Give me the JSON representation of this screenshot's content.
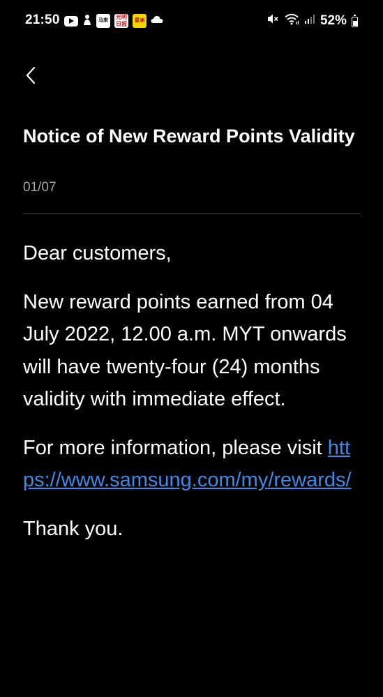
{
  "status_bar": {
    "time": "21:50",
    "app_icon_1": "马来",
    "app_icon_2_line1": "光明",
    "app_icon_2_line2": "日报",
    "app_icon_3": "星洲",
    "battery_percent": "52%",
    "icons": [
      "youtube-icon",
      "notification-icon",
      "app-icon",
      "app-icon",
      "app-icon",
      "cloud-icon",
      "mute-icon",
      "wifi-icon",
      "signal-icon",
      "battery-icon"
    ]
  },
  "header": {
    "back_icon": "chevron-left-icon",
    "title": "Notice of New Reward Points Validity",
    "date": "01/07"
  },
  "body": {
    "greeting": "Dear customers,",
    "paragraph": "New reward points earned from 04 July 2022, 12.00 a.m. MYT onwards will have twenty-four (24) months validity with immediate effect.",
    "info_prefix": "For more information, please visit",
    "link_text": "https://www.samsung.com/my/rewards/",
    "closing": "Thank you."
  },
  "colors": {
    "background": "#000000",
    "text": "#ffffff",
    "muted": "#a8a8a8",
    "link": "#3f8ae6",
    "divider": "#4a4a4a"
  }
}
